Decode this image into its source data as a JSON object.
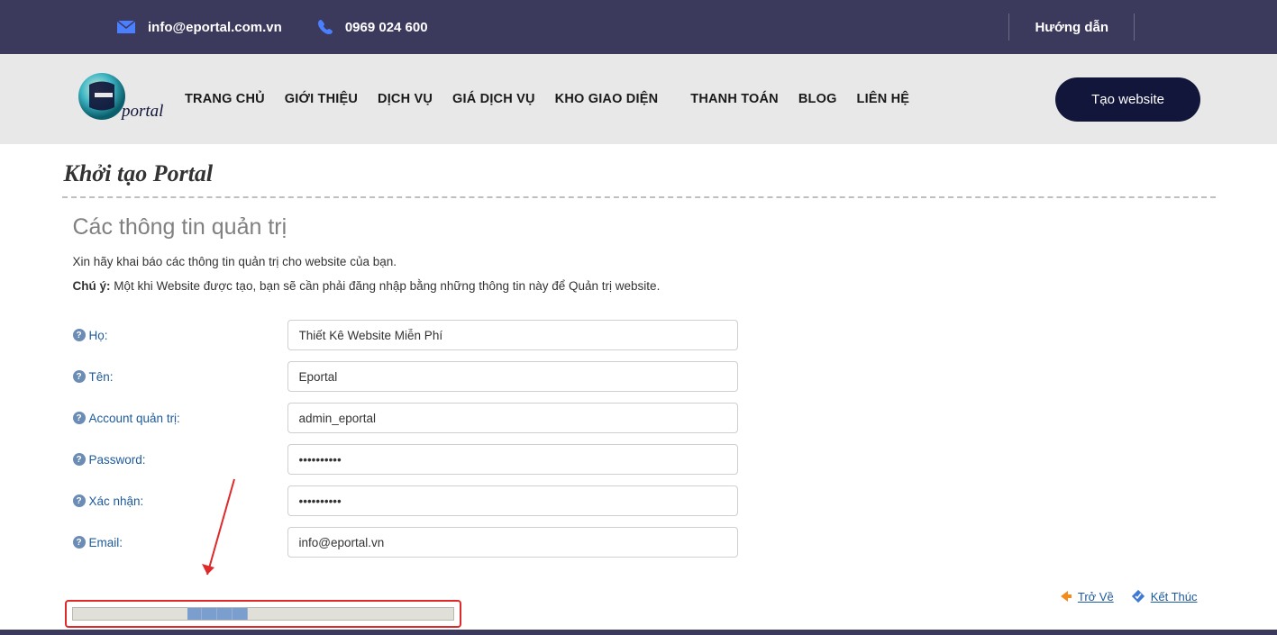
{
  "topbar": {
    "email": "info@eportal.com.vn",
    "phone": "0969 024 600",
    "guide": "Hướng dẫn"
  },
  "nav": {
    "items": [
      "TRANG CHỦ",
      "GIỚI THIỆU",
      "DỊCH VỤ",
      "GIÁ DỊCH VỤ",
      "KHO GIAO DIỆN",
      "THANH TOÁN",
      "BLOG",
      "LIÊN HỆ"
    ],
    "cta": "Tạo website"
  },
  "page": {
    "title": "Khởi tạo Portal",
    "section": "Các thông tin quản trị",
    "intro": "Xin hãy khai báo các thông tin quản trị cho website của bạn.",
    "note_label": "Chú ý:",
    "note_text": " Một khi Website được tạo, bạn sẽ cần phải đăng nhập bằng những thông tin này để Quản trị website."
  },
  "form": {
    "fields": {
      "ho": {
        "label": "Họ:",
        "value": "Thiết Kê Website Miễn Phí"
      },
      "ten": {
        "label": "Tên:",
        "value": "Eportal"
      },
      "account": {
        "label": "Account quản trị:",
        "value": "admin_eportal"
      },
      "password": {
        "label": "Password:",
        "value": "••••••••••"
      },
      "confirm": {
        "label": "Xác nhận:",
        "value": "••••••••••"
      },
      "email": {
        "label": "Email:",
        "value": "info@eportal.vn"
      }
    }
  },
  "actions": {
    "back": "Trở Về",
    "finish": "Kết Thúc"
  },
  "progress": {
    "filled_segments": 4,
    "total_segments_visible": 4
  },
  "colors": {
    "topbar_bg": "#3b3a5d",
    "accent_icon": "#4a7fff",
    "cta_bg": "#12163a",
    "link": "#1c5a9c",
    "annotation": "#de2a2a"
  }
}
